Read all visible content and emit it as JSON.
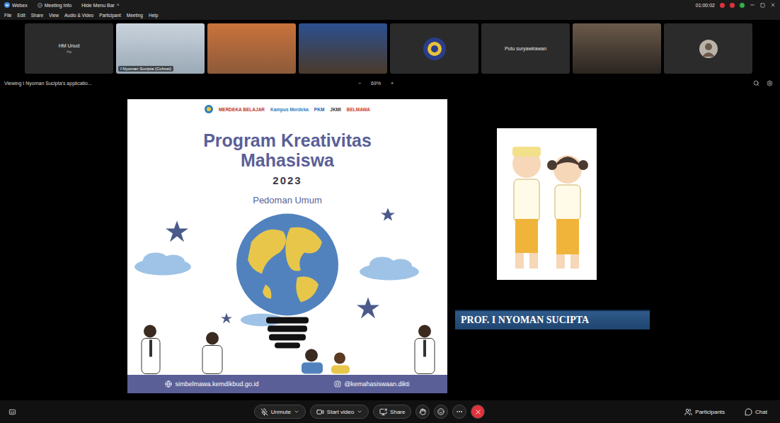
{
  "window": {
    "app": "Webex",
    "menu": [
      "Meeting Info",
      "Hide Menu Bar"
    ],
    "menu_caret": "^",
    "timer": "01:00:02"
  },
  "menu_bar": [
    "File",
    "Edit",
    "Share",
    "View",
    "Audio & Video",
    "Participant",
    "Meeting",
    "Help"
  ],
  "participants": [
    {
      "kind": "name",
      "name": "HM Unud",
      "sub": "Ha"
    },
    {
      "kind": "video",
      "name": "I Nyoman Sucipta (Cohost)"
    },
    {
      "kind": "video"
    },
    {
      "kind": "video"
    },
    {
      "kind": "logo"
    },
    {
      "kind": "name",
      "name": "Putu suryawirawan"
    },
    {
      "kind": "video"
    },
    {
      "kind": "avatar"
    }
  ],
  "share_bar": {
    "viewing": "Viewing I Nyoman Sucipta's applicatio...",
    "minus": "−",
    "zoom": "69%",
    "plus": "+"
  },
  "poster": {
    "logos": [
      "MERDEKA BELAJAR",
      "Kampus Merdeka",
      "PKM",
      "JKMI",
      "BELMAWA"
    ],
    "title": "Program Kreativitas Mahasiswa",
    "year": "2023",
    "subtitle": "Pedoman Umum",
    "footer": [
      "simbelmawa.kemdikbud.go.id",
      "@kemahasiswaan.dikti"
    ]
  },
  "caption": "PROF. I NYOMAN SUCIPTA",
  "controls": {
    "buttons": [
      {
        "label": "Unmute",
        "icon": "mic"
      },
      {
        "label": "Start video",
        "icon": "video"
      },
      {
        "label": "Share",
        "icon": "share"
      }
    ],
    "right": [
      {
        "label": "Participants",
        "icon": "users"
      },
      {
        "label": "Chat",
        "icon": "chat"
      }
    ]
  }
}
